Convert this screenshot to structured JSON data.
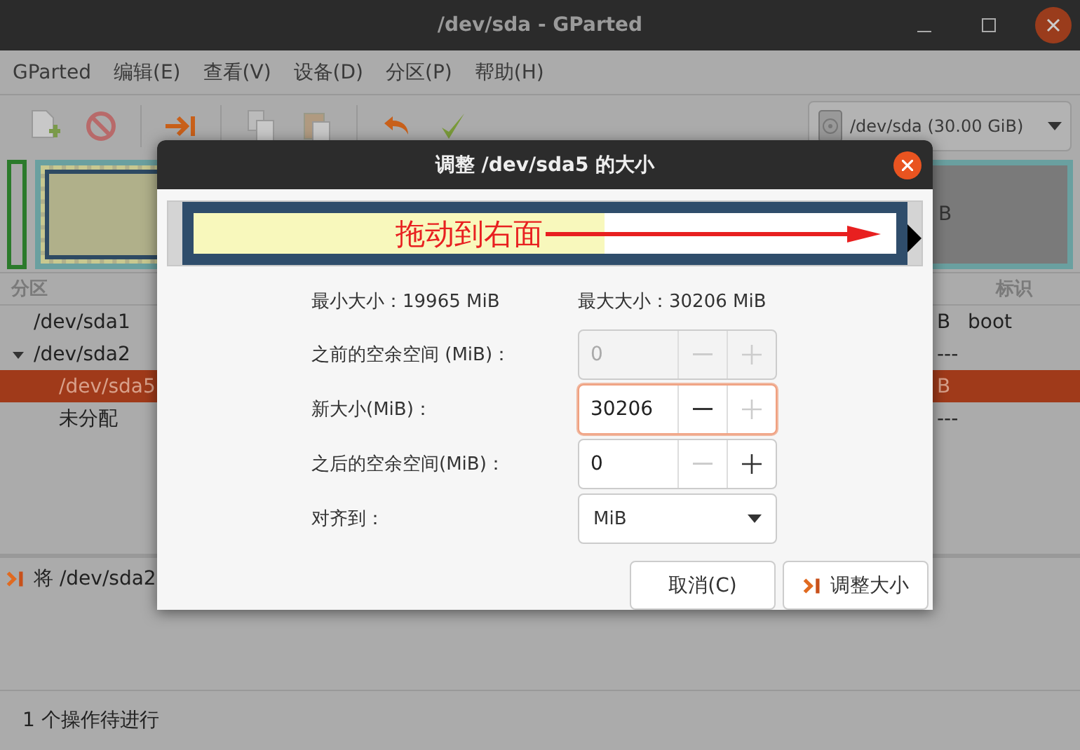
{
  "window": {
    "title": "/dev/sda - GParted"
  },
  "menu": [
    "GParted",
    "编辑(E)",
    "查看(V)",
    "设备(D)",
    "分区(P)",
    "帮助(H)"
  ],
  "device_selector": {
    "value": "/dev/sda (30.00 GiB)"
  },
  "disk_map": {
    "unallocated_text": "B"
  },
  "table": {
    "columns": [
      "分区",
      "标识"
    ],
    "rows": [
      {
        "name": "/dev/sda1",
        "column_2": "B",
        "column_3": "boot",
        "selected": false
      },
      {
        "name": "/dev/sda2",
        "column_2": "---",
        "selected": false,
        "expanded": true,
        "children": [
          {
            "name": "/dev/sda5",
            "column_2": "B",
            "selected": true
          },
          {
            "name": "未分配",
            "column_2": "---",
            "selected": false
          }
        ]
      }
    ]
  },
  "pending_operations": [
    "将 /dev/sda2"
  ],
  "status_bar": "1 个操作待进行",
  "dialog": {
    "title": "调整 /dev/sda5 的大小",
    "annotation": "拖动到右面",
    "resizer": {
      "level": 0.585
    },
    "min_size": "最小大小：19965 MiB",
    "max_size": "最大大小：30206 MiB",
    "fields": [
      {
        "kind": "spin",
        "label": "之前的空余空间 (MiB)：",
        "value": "0",
        "disabled": true,
        "focused": false,
        "minus_disabled": true,
        "plus_disabled": true
      },
      {
        "kind": "spin",
        "label": "新大小(MiB)：",
        "value": "30206",
        "disabled": false,
        "focused": true,
        "minus_disabled": false,
        "plus_disabled": true
      },
      {
        "kind": "spin",
        "label": "之后的空余空间(MiB)：",
        "value": "0",
        "disabled": false,
        "focused": false,
        "minus_disabled": true,
        "plus_disabled": false
      },
      {
        "kind": "combo",
        "label": "对齐到：",
        "value": "MiB"
      }
    ],
    "buttons": [
      {
        "kind": "cancel",
        "label": "取消(C)"
      },
      {
        "kind": "resize",
        "label": "调整大小"
      }
    ]
  }
}
